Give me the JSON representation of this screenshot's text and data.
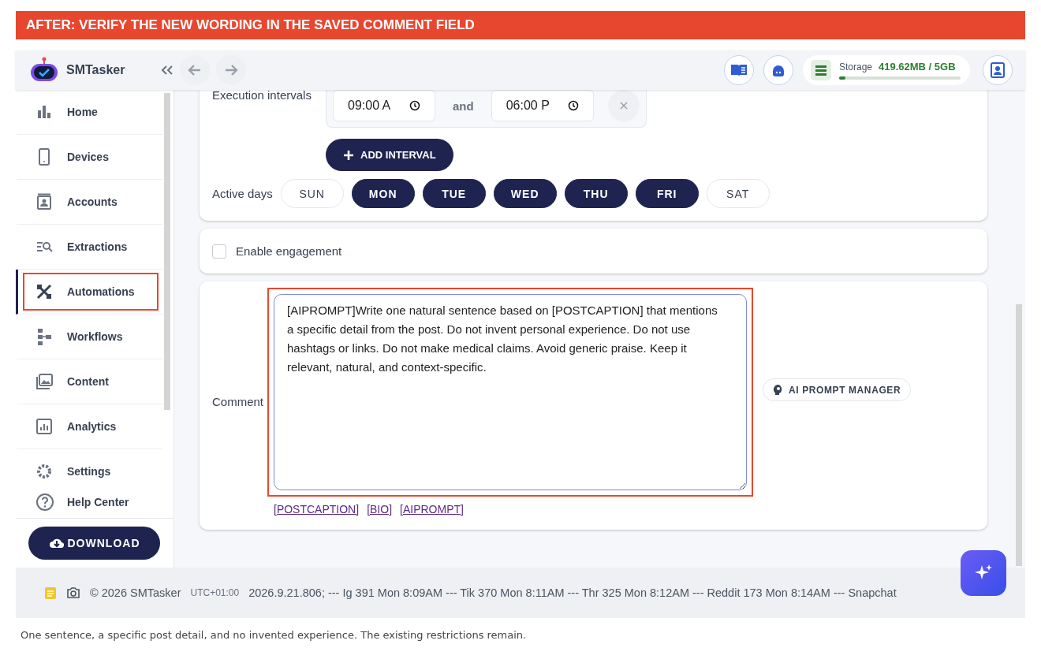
{
  "banner": {
    "text": "AFTER: VERIFY THE NEW WORDING IN THE SAVED COMMENT FIELD"
  },
  "header": {
    "app_name": "SMTasker",
    "storage": {
      "label": "Storage",
      "value": "419.62MB / 5GB",
      "level": 0.05
    }
  },
  "sidebar": {
    "items": [
      {
        "label": "Home",
        "selected": false,
        "highlighted": false
      },
      {
        "label": "Devices",
        "selected": false,
        "highlighted": false
      },
      {
        "label": "Accounts",
        "selected": false,
        "highlighted": false
      },
      {
        "label": "Extractions",
        "selected": false,
        "highlighted": false
      },
      {
        "label": "Automations",
        "selected": true,
        "highlighted": true
      },
      {
        "label": "Workflows",
        "selected": false,
        "highlighted": false
      },
      {
        "label": "Content",
        "selected": false,
        "highlighted": false
      },
      {
        "label": "Analytics",
        "selected": false,
        "highlighted": false
      },
      {
        "label": "Settings",
        "selected": false,
        "highlighted": false
      }
    ],
    "help": "Help Center",
    "download": "DOWNLOAD"
  },
  "schedule": {
    "label": "Execution intervals",
    "intervals": [
      {
        "from": "09:00 A",
        "separator": "and",
        "to": "06:00 P"
      }
    ],
    "add_button": "ADD INTERVAL",
    "days_label": "Active days",
    "days": [
      {
        "label": "SUN",
        "selected": false
      },
      {
        "label": "MON",
        "selected": true
      },
      {
        "label": "TUE",
        "selected": true
      },
      {
        "label": "WED",
        "selected": true
      },
      {
        "label": "THU",
        "selected": true
      },
      {
        "label": "FRI",
        "selected": true
      },
      {
        "label": "SAT",
        "selected": false
      }
    ]
  },
  "engagement": {
    "label": "Enable engagement",
    "checked": false
  },
  "comment": {
    "label": "Comment",
    "value": "[AIPROMPT]Write one natural sentence based on [POSTCAPTION] that mentions a specific detail from the post. Do not invent personal experience. Do not use hashtags or links. Do not make medical claims. Avoid generic praise. Keep it relevant, natural, and context-specific.",
    "highlighted": true,
    "tokens": [
      "[POSTCAPTION]",
      "[BIO]",
      "[AIPROMPT]"
    ],
    "ai_button": "AI PROMPT MANAGER"
  },
  "footer": {
    "copyright": "© 2026 SMTasker",
    "timezone": "UTC+01:00",
    "log": "2026.9.21.806; --- Ig 391 Mon 8:09AM --- Tik 370 Mon 8:11AM --- Thr 325 Mon 8:12AM --- Reddit 173 Mon 8:14AM --- Snapchat"
  },
  "caption": "One sentence, a specific post detail, and no invented experience. The existing restrictions remain."
}
